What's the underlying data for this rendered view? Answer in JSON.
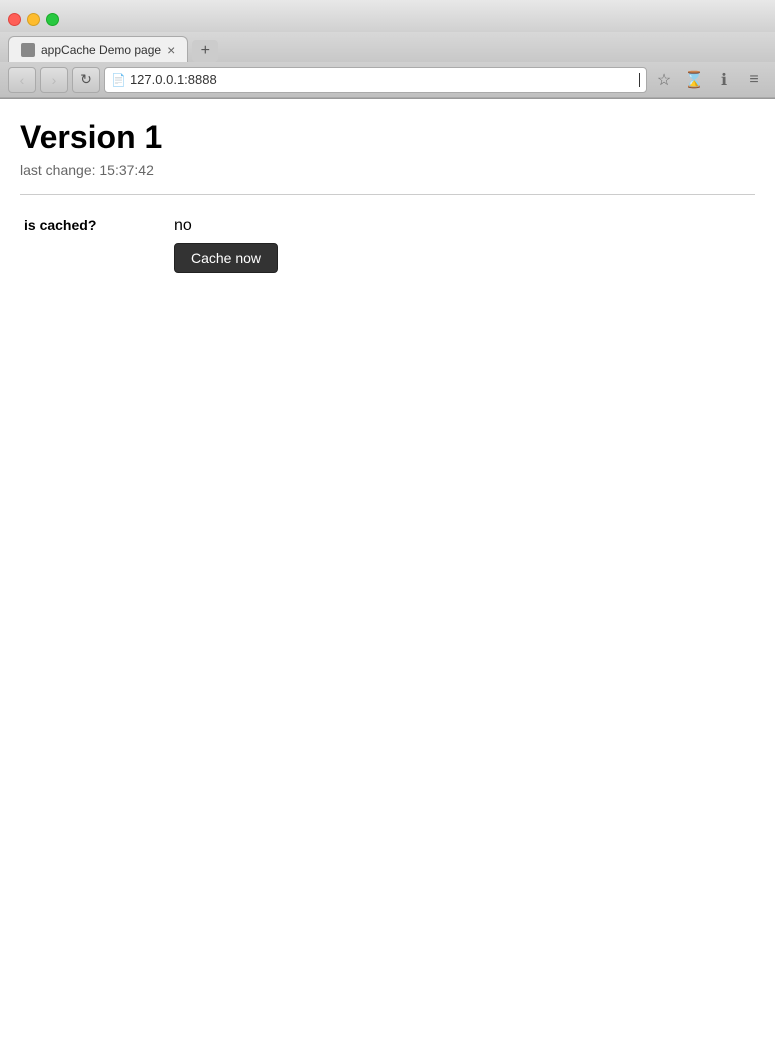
{
  "browser": {
    "tab_title": "appCache Demo page",
    "url": "127.0.0.1:8888",
    "back_btn": "‹",
    "forward_btn": "›",
    "reload_btn": "↺",
    "new_tab_btn": "+",
    "tab_close": "×",
    "bookmark_icon": "☆",
    "history_icon": "⊕",
    "info_icon": "ℹ",
    "menu_icon": "≡",
    "extension_icon": "🎩"
  },
  "page": {
    "title": "Version 1",
    "subtitle": "last change: 15:37:42",
    "cache_label": "is cached?",
    "cache_status": "no",
    "cache_button": "Cache now"
  }
}
